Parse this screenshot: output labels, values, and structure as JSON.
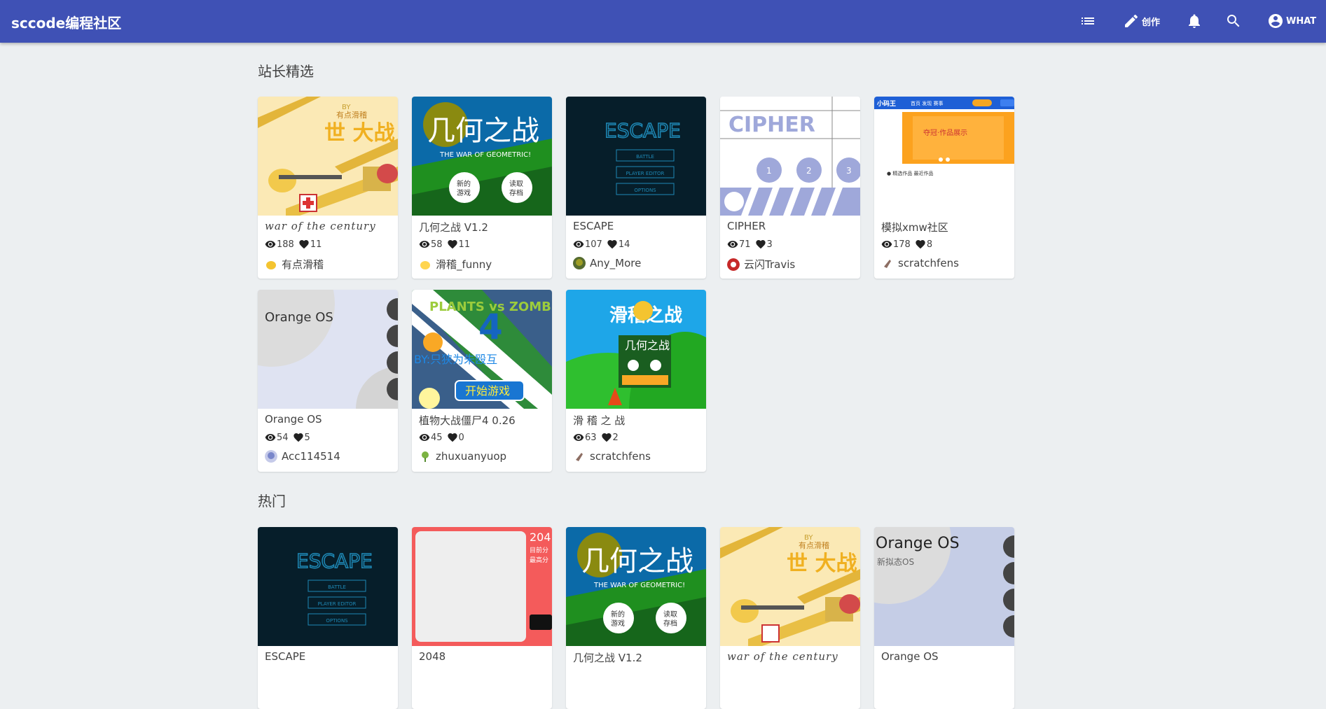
{
  "header": {
    "brand": "sccode编程社区",
    "create_label": "创作",
    "user_label": "WHAT",
    "bg_color": "#3f51b5"
  },
  "sections": {
    "featured_title": "站长精选",
    "hot_title": "热门"
  },
  "featured": [
    {
      "title": "war of the century",
      "views": "188",
      "likes": "11",
      "author": "有点滑稽",
      "thumb": "war",
      "avatar_color": "#f4c430"
    },
    {
      "title": "几何之战 V1.2",
      "views": "58",
      "likes": "11",
      "author": "滑稽_funny",
      "thumb": "geo",
      "avatar_color": "#ffd54f"
    },
    {
      "title": "ESCAPE",
      "views": "107",
      "likes": "14",
      "author": "Any_More",
      "thumb": "escape",
      "avatar_color": "#556b2f"
    },
    {
      "title": "CIPHER",
      "views": "71",
      "likes": "3",
      "author": "云闪Travis",
      "thumb": "cipher",
      "avatar_color": "#c62828"
    },
    {
      "title": "模拟xmw社区",
      "views": "178",
      "likes": "8",
      "author": "scratchfens",
      "thumb": "xmw",
      "avatar_color": "#8d6e63"
    },
    {
      "title": "Orange OS",
      "views": "54",
      "likes": "5",
      "author": "Acc114514",
      "thumb": "orange",
      "avatar_color": "#9fa8da"
    },
    {
      "title": "植物大战僵尸4 0.26",
      "views": "45",
      "likes": "0",
      "author": "zhuxuanyuop",
      "thumb": "pvz",
      "avatar_color": "#7cb342"
    },
    {
      "title": "滑 稽 之 战",
      "views": "63",
      "likes": "2",
      "author": "scratchfens",
      "thumb": "huaji",
      "avatar_color": "#8d6e63"
    }
  ],
  "hot": [
    {
      "title": "ESCAPE",
      "thumb": "escape"
    },
    {
      "title": "2048",
      "thumb": "t2048"
    },
    {
      "title": "几何之战 V1.2",
      "thumb": "geo"
    },
    {
      "title": "war of the century",
      "thumb": "war"
    },
    {
      "title": "Orange OS",
      "thumb": "orange"
    }
  ],
  "thumb_text": {
    "war_by": "BY",
    "war_author": "有点滑稽",
    "war_big": "世 大战",
    "geo_title": "几何之战",
    "geo_sub": "THE WAR OF GEOMETRIC!",
    "geo_new": "新的游戏",
    "geo_load": "读取存档",
    "escape_title": "ESCAPE",
    "escape_btn1": "BATTLE",
    "escape_btn2": "PLAYER EDITOR",
    "escape_btn3": "OPTIONS",
    "cipher_title": "CIPHER",
    "orange_title": "Orange OS",
    "orange_sub": "新拟态OS",
    "pvz_title": "PLANTS vs ZOMBIES",
    "pvz_num": "4",
    "pvz_by": "BY:只狭为朱殴互",
    "pvz_start": "开始游戏",
    "huaji_title": "滑稽之战",
    "t2048_num": "204",
    "t2048_cur": "目前分",
    "t2048_best": "最高分",
    "xmw_logo": "小码王"
  }
}
